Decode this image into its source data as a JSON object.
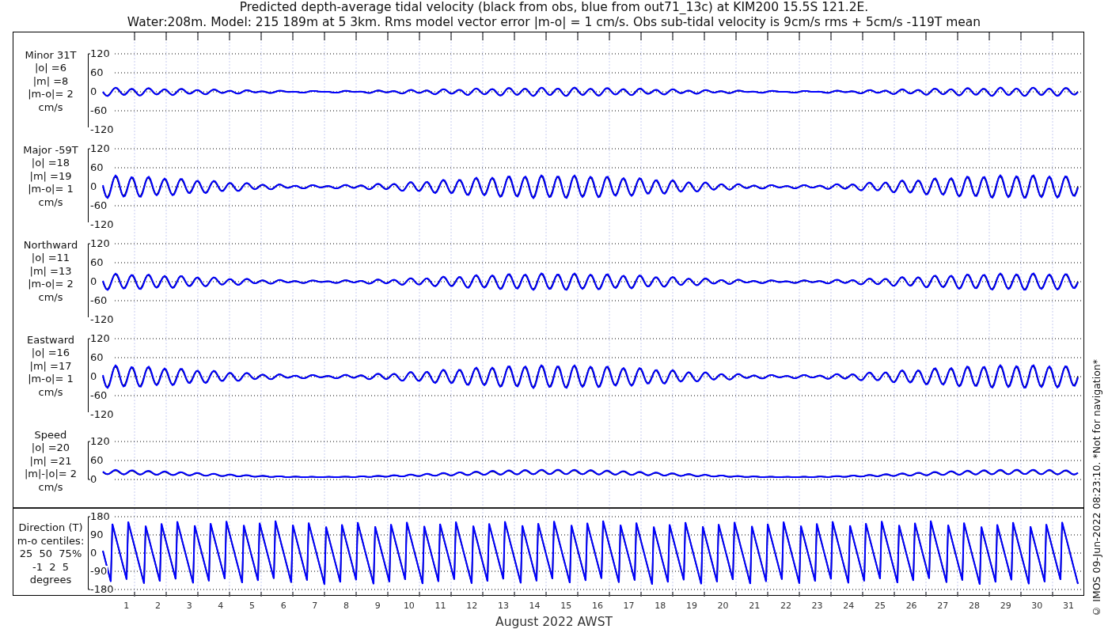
{
  "title": {
    "lines": [
      "Predicted depth-average tidal velocity (black from obs, blue from out71_13c) at KIM200 15.5S 121.2E.",
      "Water:208m. Model: 215 189m at 5 3km. Rms model vector error |m-o| = 1 cm/s. Obs sub-tidal velocity is 9cm/s rms + 5cm/s -119T mean"
    ]
  },
  "panels": [
    {
      "kind": "velocity",
      "label_lines": [
        "Minor 31T",
        "|o| =6",
        "|m| =8",
        "|m-o|= 2",
        "cm/s"
      ],
      "yticks": [
        "120",
        "60",
        "0",
        "-60",
        "-120"
      ]
    },
    {
      "kind": "velocity",
      "label_lines": [
        "Major -59T",
        "|o| =18",
        "|m| =19",
        "|m-o|= 1",
        "cm/s"
      ],
      "yticks": [
        "120",
        "60",
        "0",
        "-60",
        "-120"
      ]
    },
    {
      "kind": "velocity",
      "label_lines": [
        "Northward",
        "|o| =11",
        "|m| =13",
        "|m-o|= 2",
        "cm/s"
      ],
      "yticks": [
        "120",
        "60",
        "0",
        "-60",
        "-120"
      ]
    },
    {
      "kind": "velocity",
      "label_lines": [
        "Eastward",
        "|o| =16",
        "|m| =17",
        "|m-o|= 1",
        "cm/s"
      ],
      "yticks": [
        "120",
        "60",
        "0",
        "-60",
        "-120"
      ]
    },
    {
      "kind": "speed",
      "label_lines": [
        "Speed",
        "|o| =20",
        "|m| =21",
        "|m|-|o|= 2",
        "cm/s"
      ],
      "yticks": [
        "120",
        "60",
        "0"
      ]
    },
    {
      "kind": "direction",
      "label_lines": [
        "Direction (T)",
        "m-o centiles:",
        "25  50  75%",
        "-1  2  5",
        "degrees"
      ],
      "yticks": [
        "180",
        "90",
        "0",
        "-90",
        "-180"
      ]
    }
  ],
  "xaxis": {
    "ticks": [
      "1",
      "2",
      "3",
      "4",
      "5",
      "6",
      "7",
      "8",
      "9",
      "10",
      "11",
      "12",
      "13",
      "14",
      "15",
      "16",
      "17",
      "18",
      "19",
      "20",
      "21",
      "22",
      "23",
      "24",
      "25",
      "26",
      "27",
      "28",
      "29",
      "30",
      "31"
    ],
    "label": "August 2022 AWST"
  },
  "side_note": "© IMOS 09-Jun-2022 08:23:10. *Not for navigation*"
}
